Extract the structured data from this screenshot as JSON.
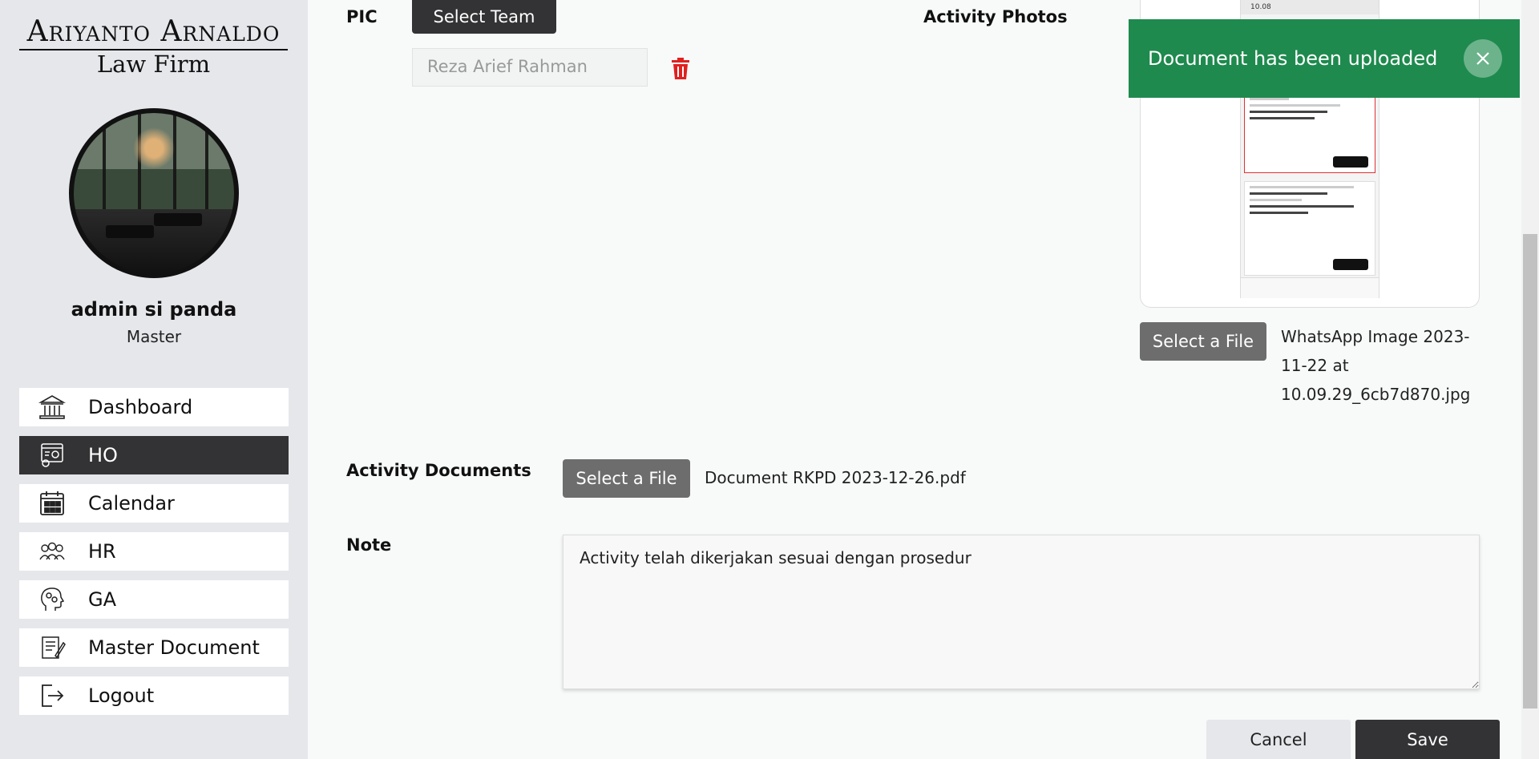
{
  "brand": {
    "line1": "Ariyanto Arnaldo",
    "line2": "Law Firm"
  },
  "user": {
    "name": "admin si panda",
    "role": "Master"
  },
  "nav": [
    {
      "label": "Dashboard",
      "icon": "bank-icon",
      "active": false
    },
    {
      "label": "HO",
      "icon": "office-settings-icon",
      "active": true
    },
    {
      "label": "Calendar",
      "icon": "calendar-icon",
      "active": false
    },
    {
      "label": "HR",
      "icon": "people-icon",
      "active": false
    },
    {
      "label": "GA",
      "icon": "head-gears-icon",
      "active": false
    },
    {
      "label": "Master Document",
      "icon": "document-edit-icon",
      "active": false
    },
    {
      "label": "Logout",
      "icon": "logout-icon",
      "active": false
    }
  ],
  "form": {
    "pic_label": "PIC",
    "select_team": "Select Team",
    "pic_member": "Reza Arief Rahman",
    "photos_label": "Activity Photos",
    "photo_select": "Select a File",
    "photo_filename": "WhatsApp Image 2023-11-22 at 10.09.29_6cb7d870.jpg",
    "docs_label": "Activity Documents",
    "doc_select": "Select a File",
    "doc_filename": "Document RKPD 2023-12-26.pdf",
    "note_label": "Note",
    "note_value": "Activity telah dikerjakan sesuai dengan prosedur",
    "cancel": "Cancel",
    "save": "Save"
  },
  "phone_preview": {
    "time": "10.08"
  },
  "toast": {
    "message": "Document has been uploaded",
    "color": "#1e8a4e"
  },
  "colors": {
    "dark": "#333335",
    "sidebar": "#e6e7eb",
    "danger": "#e02020"
  }
}
